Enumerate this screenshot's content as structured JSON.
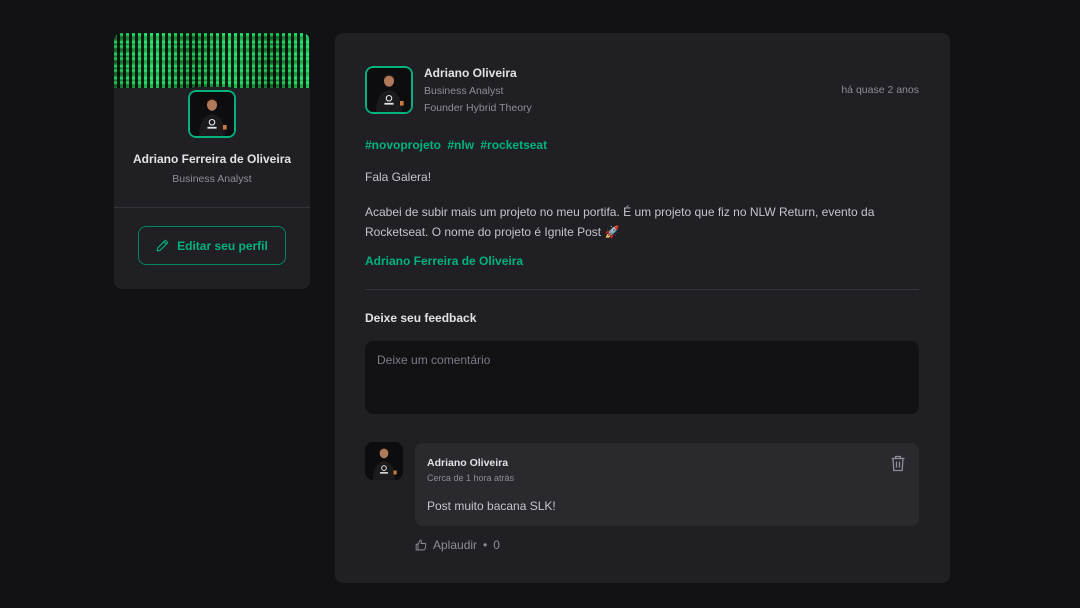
{
  "sidebar": {
    "profile_name": "Adriano Ferreira de Oliveira",
    "profile_role": "Business Analyst",
    "edit_button_label": "Editar seu perfil",
    "edit_icon": "pencil-icon"
  },
  "post": {
    "author": {
      "name": "Adriano Oliveira",
      "role": "Business Analyst",
      "role2": "Founder Hybrid Theory"
    },
    "time": "há quase 2 anos",
    "hashtags": [
      "#novoprojeto",
      "#nlw",
      "#rocketseat"
    ],
    "paragraph1": "Fala Galera!",
    "paragraph2": "Acabei de subir mais um projeto no meu portifa. É um projeto que fiz no NLW Return, evento da Rocketseat. O nome do projeto é Ignite Post 🚀",
    "link_text": "Adriano Ferreira de Oliveira"
  },
  "feedback": {
    "title": "Deixe seu feedback",
    "placeholder": "Deixe um comentário"
  },
  "comment": {
    "author": "Adriano Oliveira",
    "time": "Cerca de 1 hora atrás",
    "text": "Post muito bacana SLK!",
    "applaud_label": "Aplaudir",
    "applaud_count": "0",
    "delete_icon": "trash-icon",
    "applaud_icon": "thumbs-up-icon"
  },
  "colors": {
    "accent": "#00b37e",
    "background": "#121214",
    "card": "#202024",
    "comment_bg": "#29292e"
  }
}
